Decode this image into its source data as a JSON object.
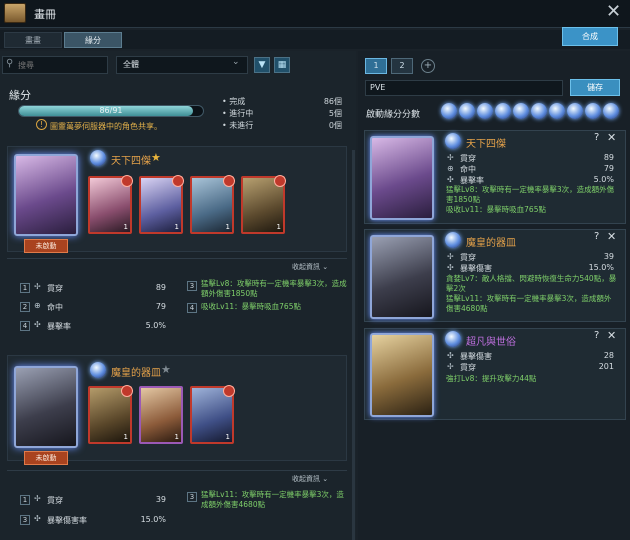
{
  "window": {
    "title": "畫冊"
  },
  "tabs": [
    {
      "label": "畫畫"
    },
    {
      "label": "緣分"
    }
  ],
  "compose_label": "合成",
  "search": {
    "placeholder": "搜尋"
  },
  "filter": {
    "selected": "全體"
  },
  "fate": {
    "label": "緣分",
    "progress_text": "86/91",
    "progress_fraction": 0.945,
    "note": "圖靈萬夢伺服器中的角色共享。",
    "stats": [
      {
        "label": "完成",
        "value": "86個"
      },
      {
        "label": "進行中",
        "value": "5個"
      },
      {
        "label": "未進行",
        "value": "0個"
      }
    ]
  },
  "sets": [
    {
      "title": "天下四傑",
      "star": "★",
      "star_color": "#e9b43c",
      "button": "未啟動",
      "collapse": "收起資訊",
      "cards": [
        {
          "n": "1",
          "purple": false
        },
        {
          "n": "1",
          "purple": false
        },
        {
          "n": "1",
          "purple": false
        },
        {
          "n": "1",
          "purple": false
        }
      ],
      "stats": [
        {
          "num": "1",
          "icon": "penetration-icon",
          "glyph": "✢",
          "name": "貫穿",
          "value": "89"
        },
        {
          "num": "2",
          "icon": "accuracy-icon",
          "glyph": "⊕",
          "name": "命中",
          "value": "79"
        },
        {
          "num": "4",
          "icon": "crit-rate-icon",
          "glyph": "✣",
          "name": "暴擊率",
          "value": "5.0%"
        }
      ],
      "effects": [
        {
          "num": "3",
          "text": "猛擊Lv8：攻擊時有一定機率暴擊3次，造成額外傷害1850點"
        },
        {
          "num": "4",
          "text": "吸收Lv11：暴擊時吸血765點"
        }
      ]
    },
    {
      "title": "魔皇的器皿",
      "star": "★",
      "star_color": "#7f8a92",
      "button": "未啟動",
      "collapse": "收起資訊",
      "cards": [
        {
          "n": "1",
          "purple": false
        },
        {
          "n": "1",
          "purple": true
        },
        {
          "n": "1",
          "purple": false
        }
      ],
      "stats": [
        {
          "num": "1",
          "icon": "penetration-icon",
          "glyph": "✢",
          "name": "貫穿",
          "value": "39"
        },
        {
          "num": "3",
          "icon": "crit-damage-icon",
          "glyph": "✣",
          "name": "暴擊傷害率",
          "value": "15.0%"
        }
      ],
      "effects": [
        {
          "num": "3",
          "text": "猛擊Lv11：攻擊時有一定機率暴擊3次，造成額外傷害4680點"
        }
      ]
    }
  ],
  "right": {
    "pages": [
      "1",
      "2"
    ],
    "add": "+",
    "pve": "PVE",
    "save": "儲存",
    "score_label": "啟動緣分分數",
    "cards": [
      {
        "title": "天下四傑",
        "title_color": "#e5a24a",
        "stats": [
          {
            "glyph": "✢",
            "icon": "penetration-icon",
            "name": "貫穿",
            "value": "89"
          },
          {
            "glyph": "⊕",
            "icon": "accuracy-icon",
            "name": "命中",
            "value": "79"
          },
          {
            "glyph": "✣",
            "icon": "crit-rate-icon",
            "name": "暴擊率",
            "value": "5.0%"
          }
        ],
        "effects": [
          "猛擊Lv8：攻擊時有一定機率暴擊3次，造成額外傷害1850點",
          "吸收Lv11：暴擊時吸血765點"
        ]
      },
      {
        "title": "魔皇的器皿",
        "title_color": "#e5a24a",
        "stats": [
          {
            "glyph": "✢",
            "icon": "penetration-icon",
            "name": "貫穿",
            "value": "39"
          },
          {
            "glyph": "✣",
            "icon": "crit-damage-icon",
            "name": "暴擊傷害",
            "value": "15.0%"
          }
        ],
        "effects": [
          "貪婪Lv7：敵人格擋、閃避時恢復生命力540點，暴擊2次",
          "猛擊Lv11：攻擊時有一定機率暴擊3次，造成額外傷害4680點"
        ]
      },
      {
        "title": "超凡與世俗",
        "title_color": "#c070e0",
        "stats": [
          {
            "glyph": "✣",
            "icon": "crit-damage-icon",
            "name": "暴擊傷害",
            "value": "28"
          },
          {
            "glyph": "✢",
            "icon": "penetration-icon",
            "name": "貫穿",
            "value": "201"
          }
        ],
        "effects": [
          "強打Lv8：提升攻擊力44點"
        ]
      }
    ]
  }
}
